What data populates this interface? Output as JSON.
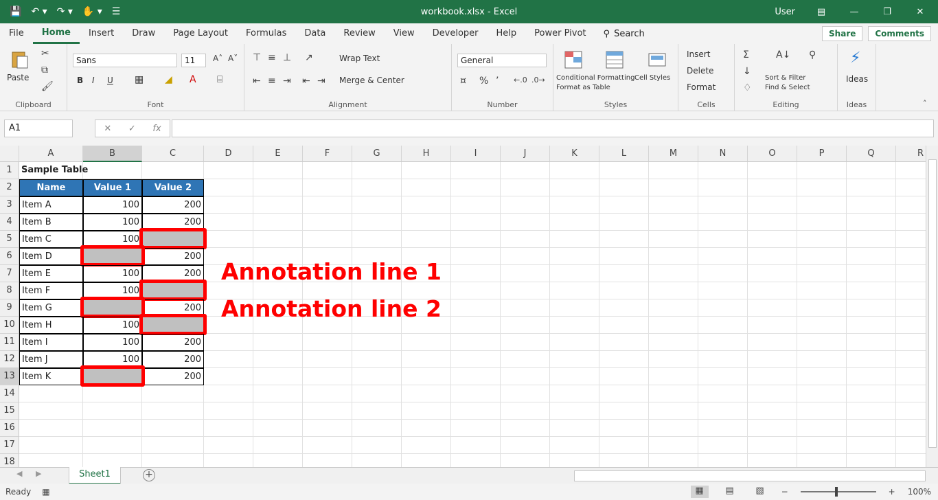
{
  "titlebar": {
    "file_title": "workbook.xlsx - Excel",
    "user": "User",
    "qat_icons": [
      "save-icon",
      "undo-icon",
      "redo-icon",
      "touch-mode-icon",
      "customize-icon"
    ]
  },
  "menu": {
    "tabs": [
      "File",
      "Home",
      "Insert",
      "Draw",
      "Page Layout",
      "Formulas",
      "Data",
      "Review",
      "View",
      "Developer",
      "Help",
      "Power Pivot"
    ],
    "search_label": "Search",
    "share_label": "Share",
    "comment_label": "Comments"
  },
  "ribbon": {
    "clipboard": {
      "label": "Clipboard",
      "paste": "Paste"
    },
    "font": {
      "label": "Font",
      "name": "Sans",
      "size": "11",
      "bold": "B",
      "italic": "I",
      "underline": "U"
    },
    "alignment": {
      "label": "Alignment",
      "wrap": "Wrap Text",
      "merge": "Merge & Center"
    },
    "number": {
      "label": "Number",
      "format": "General"
    },
    "styles": {
      "label": "Styles",
      "cond": "Conditional Formatting",
      "table": "Format as Table",
      "cell": "Cell Styles"
    },
    "cells": {
      "label": "Cells",
      "insert": "Insert",
      "delete": "Delete",
      "format": "Format"
    },
    "editing": {
      "label": "Editing",
      "sort": "Sort & Filter",
      "find": "Find & Select"
    },
    "ideas": {
      "label": "Ideas",
      "btn": "Ideas"
    }
  },
  "formula_bar": {
    "name_box": "A1",
    "formula": ""
  },
  "grid": {
    "columns": [
      "A",
      "B",
      "C",
      "D",
      "E",
      "F",
      "G",
      "H",
      "I",
      "J",
      "K",
      "L",
      "M",
      "N",
      "O",
      "P",
      "Q",
      "R"
    ],
    "rows": [
      "1",
      "2",
      "3",
      "4",
      "5",
      "6",
      "7",
      "8",
      "9",
      "10",
      "11",
      "12",
      "13",
      "14",
      "15",
      "16",
      "17",
      "18"
    ],
    "title": "Sample Table",
    "headers": [
      "Name",
      "Value 1",
      "Value 2"
    ],
    "records": [
      {
        "name": "Item A",
        "b": "100",
        "c": "200"
      },
      {
        "name": "Item B",
        "b": "100",
        "c": "200"
      },
      {
        "name": "Item C",
        "b": "100",
        "c": ""
      },
      {
        "name": "Item D",
        "b": "",
        "c": "200"
      },
      {
        "name": "Item E",
        "b": "100",
        "c": "200"
      },
      {
        "name": "Item F",
        "b": "100",
        "c": ""
      },
      {
        "name": "Item G",
        "b": "",
        "c": "200"
      },
      {
        "name": "Item H",
        "b": "100",
        "c": ""
      },
      {
        "name": "Item I",
        "b": "100",
        "c": "200"
      },
      {
        "name": "Item J",
        "b": "100",
        "c": "200"
      },
      {
        "name": "Item K",
        "b": "",
        "c": "200"
      }
    ]
  },
  "annotation": {
    "line1": "Annotation line 1",
    "line2": "Annotation line 2"
  },
  "sheet": {
    "tab": "Sheet1",
    "add": "+"
  },
  "status": {
    "ready": "Ready",
    "zoom": "100%"
  },
  "colors": {
    "brand": "#217346",
    "header_fill": "#2f75b5",
    "highlight": "#ff0000",
    "blank_fill": "#c0c0c0"
  }
}
